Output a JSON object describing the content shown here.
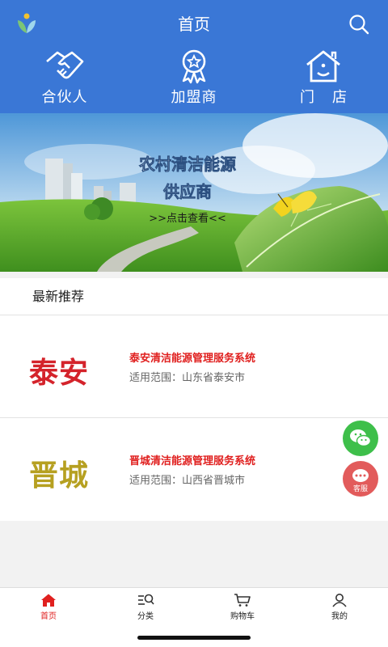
{
  "header": {
    "title": "首页"
  },
  "categories": [
    {
      "label": "合伙人",
      "icon": "handshake-icon"
    },
    {
      "label": "加盟商",
      "icon": "award-badge-icon"
    },
    {
      "label": "门店",
      "icon": "house-icon"
    }
  ],
  "banner": {
    "line1": "农村清洁能源",
    "line2": "供应商",
    "link": ">>点击查看<<"
  },
  "recommend": {
    "title": "最新推荐",
    "items": [
      {
        "brand": "泰安",
        "name": "泰安清洁能源管理服务系统",
        "scope": "适用范围：山东省泰安市"
      },
      {
        "brand": "晋城",
        "name": "晋城清洁能源管理服务系统",
        "scope": "适用范围：山西省晋城市"
      }
    ]
  },
  "float": {
    "service_label": "客服"
  },
  "tabs": [
    {
      "label": "首页",
      "icon": "home-icon",
      "active": true
    },
    {
      "label": "分类",
      "icon": "category-icon"
    },
    {
      "label": "购物车",
      "icon": "cart-icon"
    },
    {
      "label": "我的",
      "icon": "user-icon"
    }
  ],
  "colors": {
    "primary": "#3a77d6",
    "accent": "#e0201f",
    "wechat": "#3ebf4a"
  }
}
